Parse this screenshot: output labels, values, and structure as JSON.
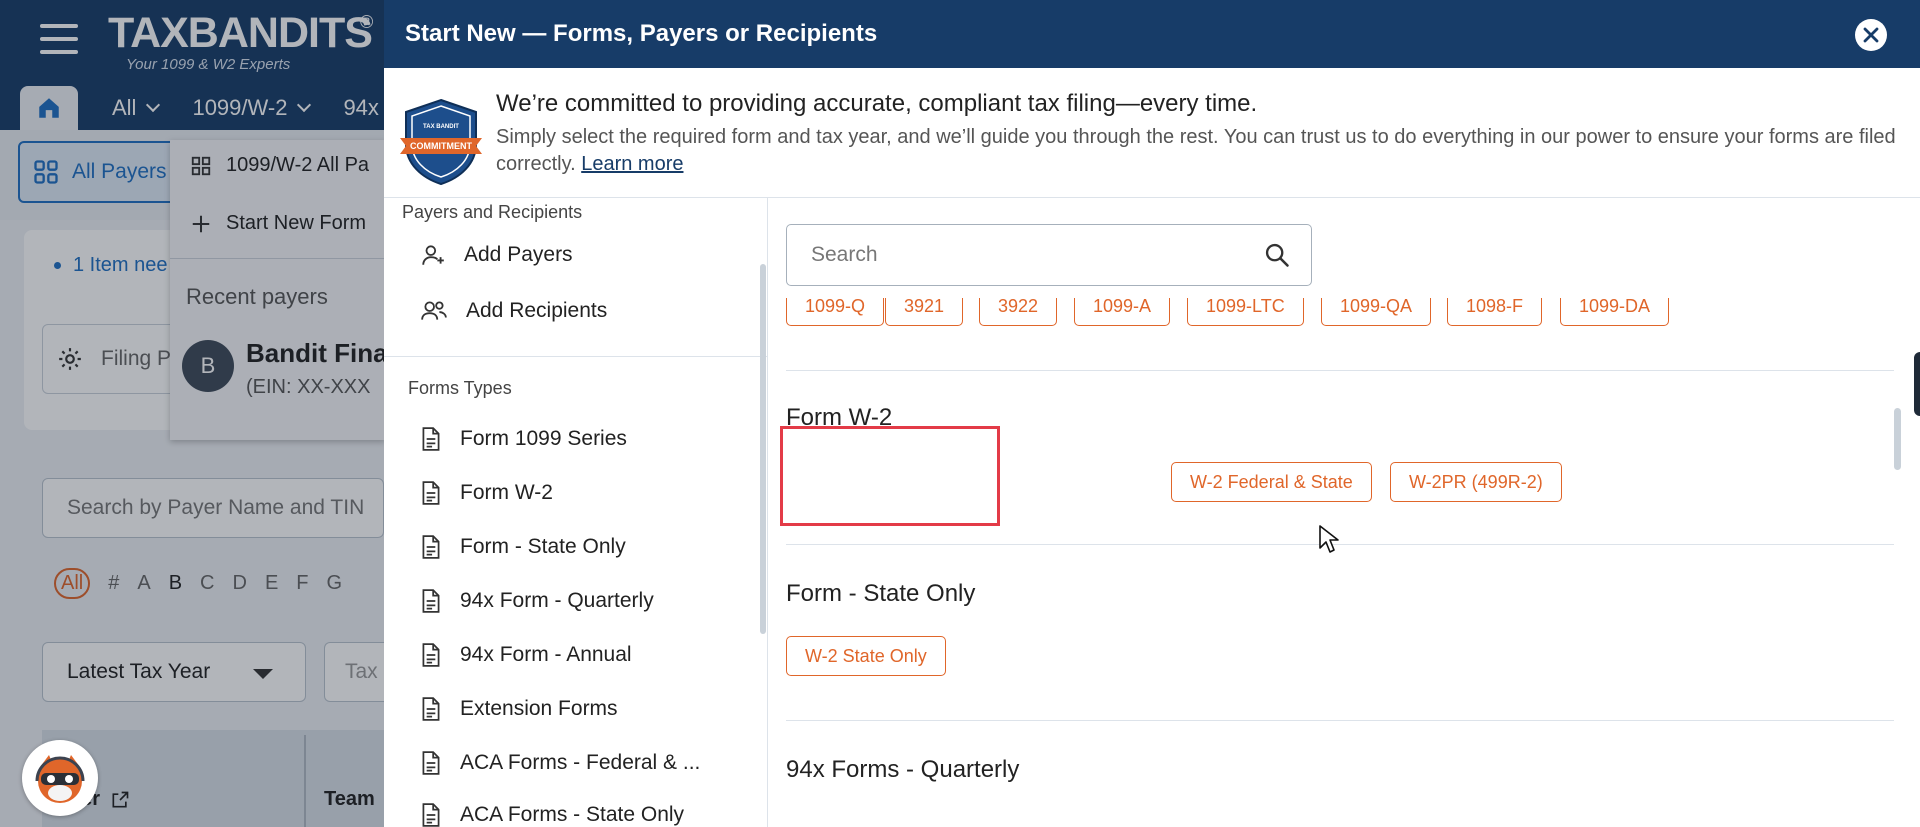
{
  "app": {
    "logo": "TAXBANDITS",
    "logo_reg": "®",
    "tagline": "Your 1099 & W2 Experts",
    "nav": [
      "All",
      "1099/W-2",
      "94x"
    ],
    "all_payers_tab": "All Payers",
    "dropdown": {
      "item1": "1099/W-2 All Pa",
      "item2": "Start New Form",
      "recent_label": "Recent payers",
      "avatar_initial": "B",
      "payer_name": "Bandit Fina",
      "payer_ein": "(EIN: XX-XXX"
    },
    "notice": "1 Item nee",
    "filing_box": "Filing P",
    "payer_search_placeholder": "Search by Payer Name and TIN",
    "alphabet": [
      "All",
      "#",
      "A",
      "B",
      "C",
      "D",
      "E",
      "F",
      "G"
    ],
    "tax_year_select": "Latest Tax Year",
    "tax_box2": "Tax",
    "col_payer": "yer",
    "col_team": "Team"
  },
  "modal": {
    "title": "Start New — Forms, Payers or Recipients",
    "banner": {
      "badge_top": "TAX BANDIT",
      "badge_ribbon": "COMMITMENT",
      "heading": "We’re committed to providing accurate, compliant tax filing—every time.",
      "body": "Simply select the required form and tax year, and we’ll guide you through the rest. You can trust us to do everything in our power to ensure your forms are filed correctly.",
      "link": "Learn more"
    },
    "left": {
      "payers_label": "Payers and Recipients",
      "payer_items": [
        "Add Payers",
        "Add Recipients"
      ],
      "forms_label": "Forms Types",
      "form_items": [
        "Form 1099 Series",
        "Form W-2",
        "Form - State Only",
        "94x Form - Quarterly",
        "94x Form - Annual",
        "Extension Forms",
        "ACA Forms - Federal & ...",
        "ACA Forms - State Only"
      ]
    },
    "right": {
      "search_placeholder": "Search",
      "cut_chips": [
        "1099-Q",
        "3921",
        "3922",
        "1099-A",
        "1099-LTC",
        "1099-QA",
        "1098-F",
        "1099-DA"
      ],
      "groups": [
        {
          "title": "Form W-2",
          "chips": [
            "W-2 Federal & State",
            "W-2PR (499R-2)"
          ]
        },
        {
          "title": "Form - State Only",
          "chips": [
            "W-2 State Only"
          ]
        },
        {
          "title": "94x Forms - Quarterly",
          "chips": []
        }
      ]
    }
  },
  "colors": {
    "header": "#173c68",
    "accent": "#e0662a",
    "link": "#1e6fc2",
    "highlight": "#e33b47"
  }
}
